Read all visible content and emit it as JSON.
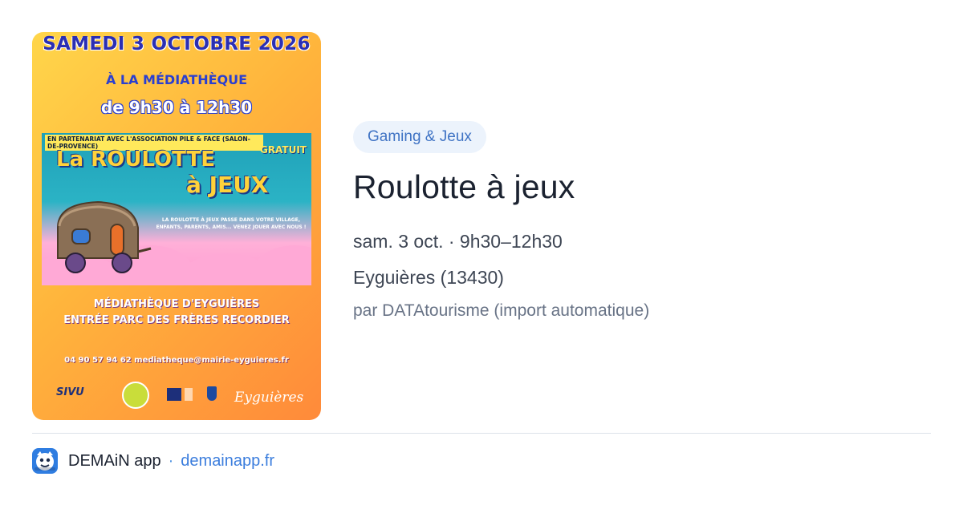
{
  "poster": {
    "date": "SAMEDI 3 OCTOBRE 2026",
    "venue": "À LA MÉDIATHÈQUE",
    "hours": "de 9h30 à 12h30",
    "partner": "EN PARTENARIAT AVEC L'ASSOCIATION PILE & FACE (SALON-DE-PROVENCE)",
    "free": "GRATUIT",
    "title_line1": "La ROULOTTE",
    "title_line2": "à JEUX",
    "subtitle": "LA ROULOTTE À JEUX PASSE DANS VOTRE VILLAGE, ENFANTS, PARENTS, AMIS... VENEZ JOUER AVEC NOUS !",
    "address_line1": "MÉDIATHÈQUE D'EYGUIÈRES",
    "address_line2": "ENTRÉE PARC DES FRÈRES RECORDIER",
    "contact": "04 90 57 94 62 mediatheque@mairie-eyguieres.fr",
    "logo_sivu": "SIVU",
    "logo_eyguieres": "Eyguières"
  },
  "event": {
    "category": "Gaming & Jeux",
    "title": "Roulotte à jeux",
    "datetime": "sam. 3 oct. · 9h30–12h30",
    "location": "Eyguières (13430)",
    "source": "par DATAtourisme (import automatique)"
  },
  "footer": {
    "icon": "app-logo-icon",
    "app_name": "DEMAiN app",
    "separator": "·",
    "domain": "demainapp.fr"
  },
  "colors": {
    "chip_bg": "#ecf3fc",
    "chip_text": "#3f73c4",
    "link": "#3b7ddd",
    "app_icon": "#2f7de1"
  }
}
